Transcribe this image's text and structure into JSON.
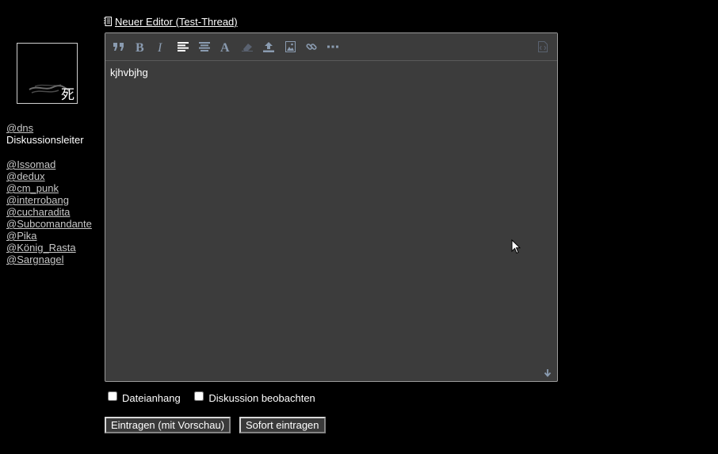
{
  "thread": {
    "title": "Neuer Editor (Test-Thread)"
  },
  "sidebar": {
    "author": "@dns",
    "role": "Diskussionsleiter",
    "avatar_glyph": "死",
    "mentions": [
      "@Issomad",
      "@dedux",
      "@cm_punk",
      "@interrobang",
      "@cucharadita",
      "@Subcomandante",
      "@Pika",
      "@König_Rasta",
      "@Sargnagel"
    ]
  },
  "editor": {
    "content": "kjhvbjhg",
    "toolbar": [
      "quote-icon",
      "bold-icon",
      "italic-icon",
      "align-left-icon",
      "align-center-icon",
      "font-icon",
      "eraser-icon",
      "upload-icon",
      "image-icon",
      "link-icon",
      "more-icon",
      "source-icon"
    ]
  },
  "options": {
    "attachment_label": "Dateianhang",
    "watch_label": "Diskussion beobachten"
  },
  "buttons": {
    "preview_label": "Eintragen (mit Vorschau)",
    "submit_label": "Sofort eintragen"
  },
  "colors": {
    "background": "#000000",
    "editor_bg": "#3c3c3c",
    "icon": "#8a9bb0",
    "link": "#c7c7c7"
  }
}
